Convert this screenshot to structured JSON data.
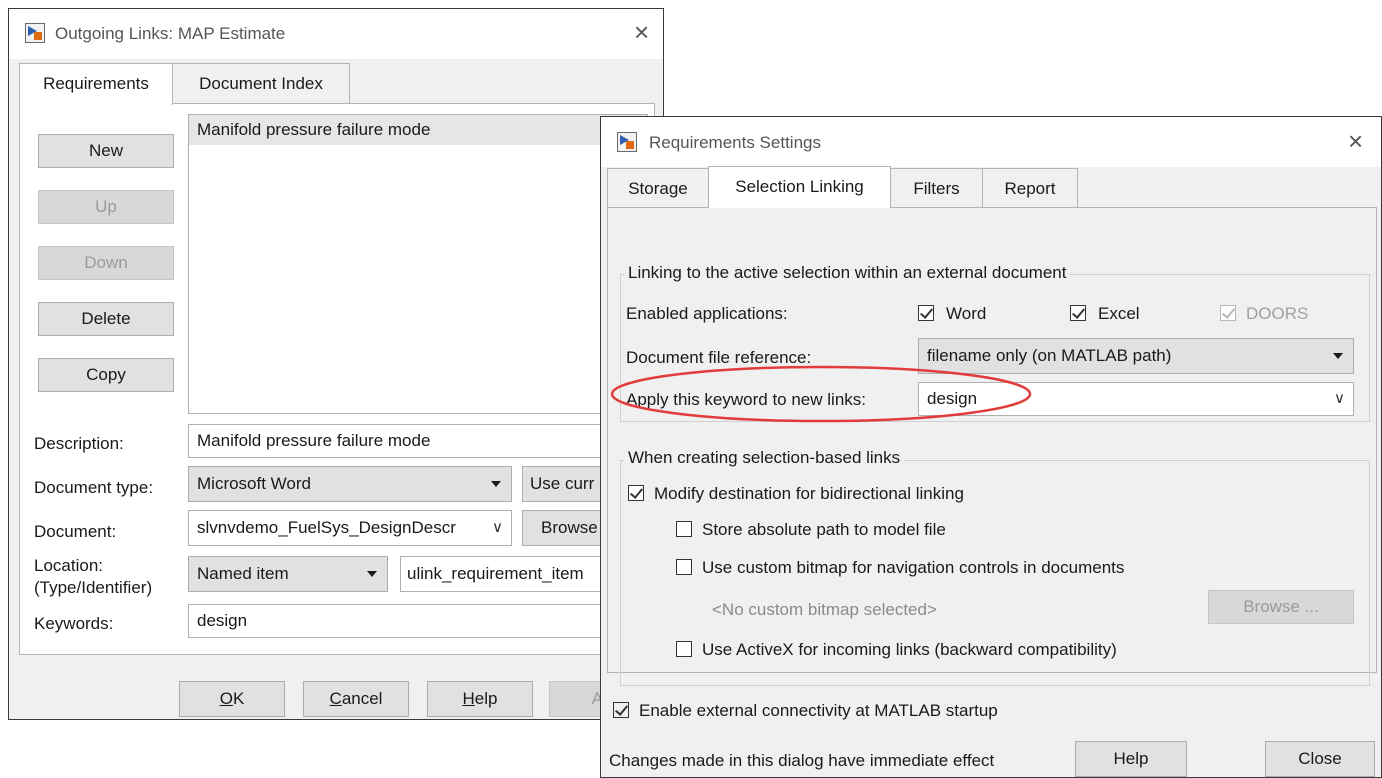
{
  "left_dialog": {
    "title": "Outgoing Links: MAP Estimate",
    "tabs": [
      "Requirements",
      "Document Index"
    ],
    "buttons": {
      "new": "New",
      "up": "Up",
      "down": "Down",
      "delete": "Delete",
      "copy": "Copy"
    },
    "list_items": [
      "Manifold pressure failure mode"
    ],
    "form": {
      "description_label": "Description:",
      "description_value": "Manifold pressure failure mode",
      "doctype_label": "Document type:",
      "doctype_value": "Microsoft Word",
      "use_current_label": "Use curr",
      "document_label": "Document:",
      "document_value": "slvnvdemo_FuelSys_DesignDescr",
      "browse_label": "Browse",
      "location_label_1": "Location:",
      "location_label_2": "(Type/Identifier)",
      "location_type_value": "Named item",
      "location_id_value": "ulink_requirement_item",
      "keywords_label": "Keywords:",
      "keywords_value": "design"
    },
    "footer": {
      "ok_mn": "O",
      "ok_rest": "K",
      "cancel_mn": "C",
      "cancel_rest": "ancel",
      "help_mn": "H",
      "help_rest": "elp",
      "apply_partial": "Ap"
    }
  },
  "right_dialog": {
    "title": "Requirements Settings",
    "tabs": [
      "Storage",
      "Selection Linking",
      "Filters",
      "Report"
    ],
    "group1": {
      "title": "Linking to the active selection within an external document",
      "enabled_apps_label": "Enabled applications:",
      "app_word": "Word",
      "app_excel": "Excel",
      "app_doors": "DOORS",
      "doc_ref_label": "Document file reference:",
      "doc_ref_value": "filename only (on MATLAB path)",
      "keyword_label": "Apply this keyword to new links:",
      "keyword_value": "design"
    },
    "group2": {
      "title": "When creating selection-based links",
      "modify_dest": "Modify destination for bidirectional linking",
      "store_abs": "Store absolute path to model file",
      "custom_bitmap": "Use custom bitmap for navigation controls in documents",
      "no_bitmap": "<No custom bitmap selected>",
      "browse": "Browse ...",
      "activex": "Use ActiveX for incoming links (backward compatibility)"
    },
    "enable_external": "Enable external connectivity at MATLAB startup",
    "status_text": "Changes made in this dialog have immediate effect",
    "help": "Help",
    "close": "Close"
  },
  "colors": {
    "highlight_ellipse": "#e23b3b",
    "list_selection": "#e6e6e6"
  }
}
